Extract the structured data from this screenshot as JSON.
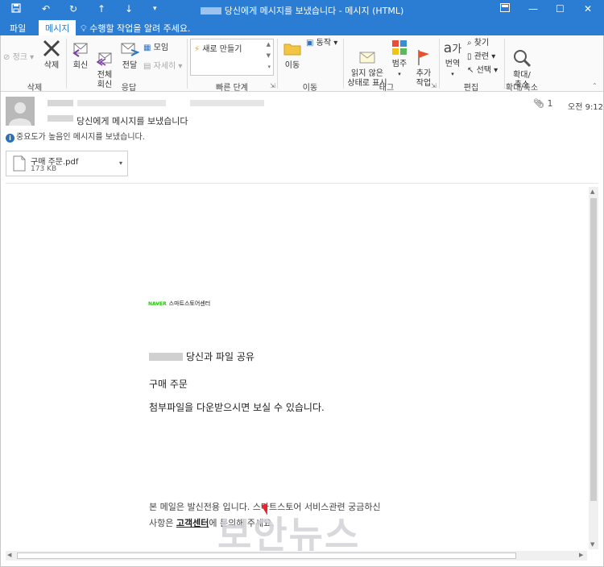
{
  "window": {
    "title": "당신에게 메시지를 보냈습니다 - 메시지 (HTML)"
  },
  "menu": {
    "file": "파일",
    "message": "메시지",
    "tell_me": "수행할 작업을 알려 주세요."
  },
  "ribbon": {
    "junk": "정크",
    "delete": "삭제",
    "reply": "회신",
    "reply_all": "전체\n회신",
    "forward": "전달",
    "meeting": "모임",
    "more": "자세히",
    "quick_new": "새로 만들기",
    "move": "이동",
    "actions": "동작",
    "mark_unread": "읽지 않은\n상태로 표시",
    "categorize": "범주",
    "followup": "추가\n작업",
    "translate": "번역",
    "find": "찾기",
    "related": "관련",
    "select": "선택",
    "zoom": "확대/\n축소",
    "groups": {
      "delete": "삭제",
      "respond": "응답",
      "quick_steps": "빠른 단계",
      "move": "이동",
      "tags": "태그",
      "editing": "편집",
      "zoom": "확대/축소"
    }
  },
  "header": {
    "subject": "당신에게 메시지를 보냈습니다",
    "attachment_count": "1",
    "time": "오전 9:12",
    "importance_note": "중요도가 높음인 메시지를 보냈습니다."
  },
  "attachment": {
    "name": "구매 주문.pdf",
    "size": "173 KB"
  },
  "body": {
    "brand_logo": "NAVER",
    "brand_name": "스마트스토어센터",
    "line1": "당신과 파일 공유",
    "line2": "구매 주문",
    "line3": "첨부파일을 다운받으시면 보실 수 있습니다.",
    "footer1": "본 메일은 발신전용 입니다. 스마트스토어 서비스관련 궁금하신",
    "footer2_pre": "사항은",
    "footer2_link": "고객센터",
    "footer2_post": "에 문의해 주세요."
  },
  "watermark": "보안뉴스",
  "colors": {
    "titlebar": "#2b7cd3",
    "naver_green": "#1ec800"
  }
}
